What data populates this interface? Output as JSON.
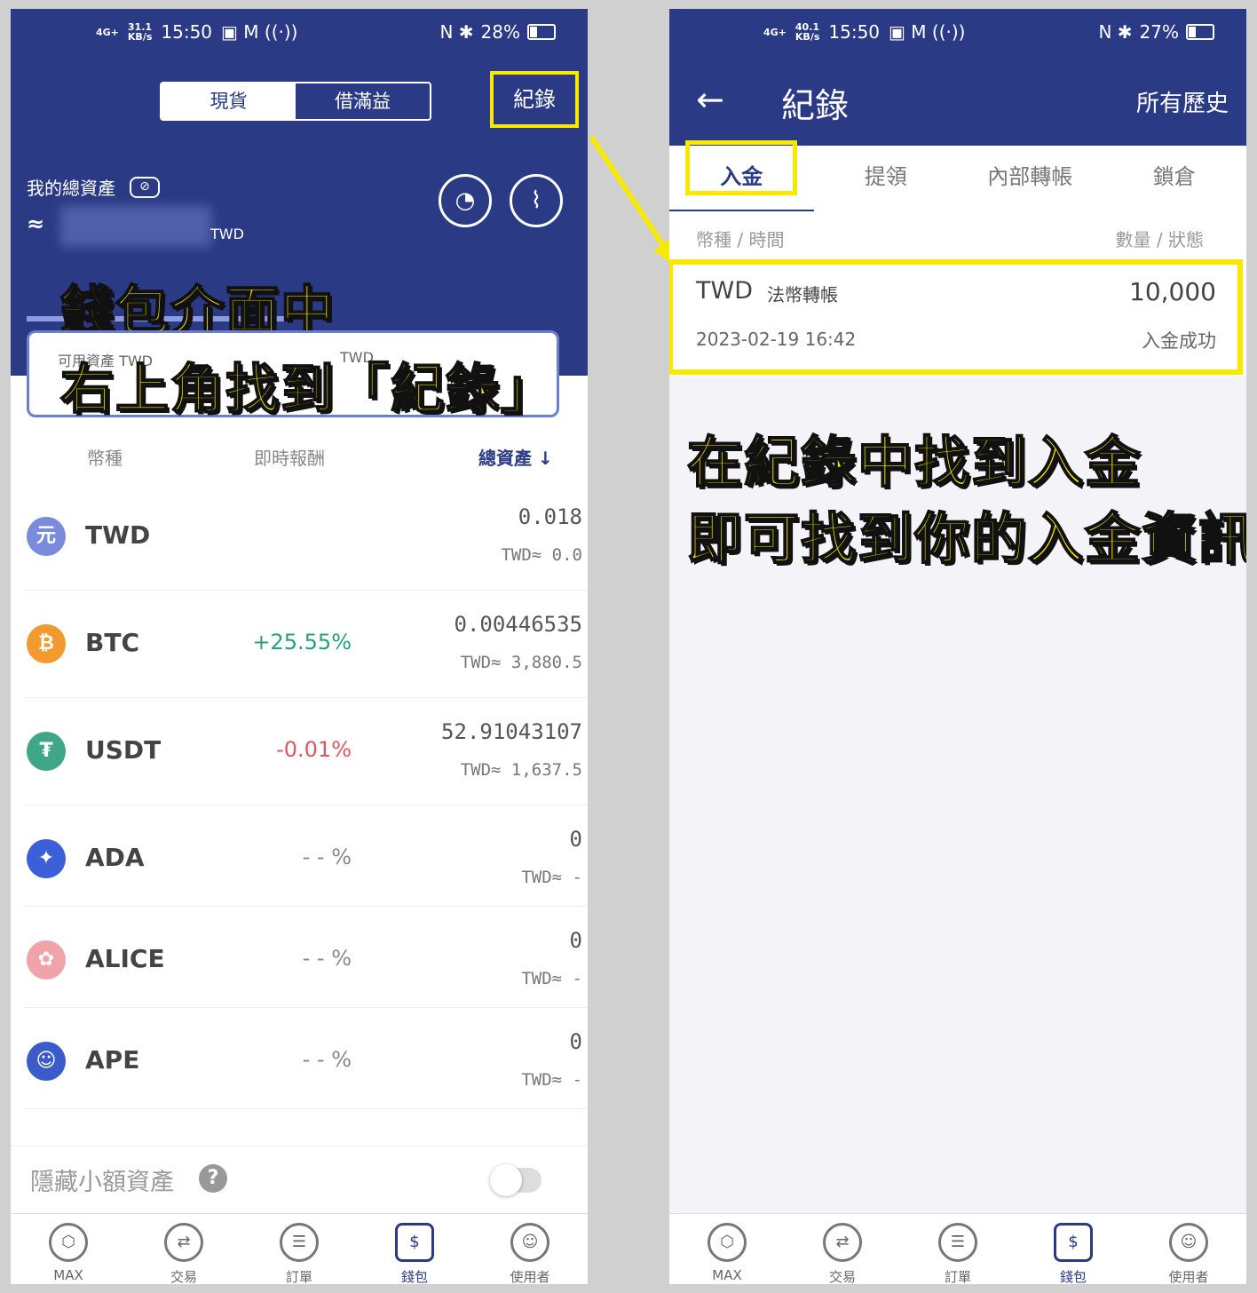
{
  "left": {
    "status": {
      "net": "4G+",
      "speed": "31.1",
      "speed_unit": "KB/s",
      "time": "15:50",
      "battery": "28%"
    },
    "segment": [
      "現貨",
      "借滿益"
    ],
    "records_link": "紀錄",
    "total_label": "我的總資產",
    "currency": "TWD",
    "overlay_line1": "錢包介面中",
    "overlay_line2": "右上角找到「紀錄」",
    "columns": {
      "coin": "幣種",
      "pnl": "即時報酬",
      "total": "總資產 ↓"
    },
    "coins": [
      {
        "icon": "元",
        "name": "TWD",
        "pct": "",
        "amount": "0.018",
        "twd": "TWD≈ 0.0",
        "color": "#7a8bdb"
      },
      {
        "icon": "₿",
        "name": "BTC",
        "pct": "+25.55%",
        "amount": "0.00446535",
        "twd": "TWD≈ 3,880.5",
        "color": "#f29a2e"
      },
      {
        "icon": "₮",
        "name": "USDT",
        "pct": "-0.01%",
        "amount": "52.91043107",
        "twd": "TWD≈ 1,637.5",
        "color": "#3fa687"
      },
      {
        "icon": "✦",
        "name": "ADA",
        "pct": "- - %",
        "amount": "0",
        "twd": "TWD≈ -",
        "color": "#3b5fd9"
      },
      {
        "icon": "✿",
        "name": "ALICE",
        "pct": "- - %",
        "amount": "0",
        "twd": "TWD≈ -",
        "color": "#f0a3a8"
      },
      {
        "icon": "☺",
        "name": "APE",
        "pct": "- - %",
        "amount": "0",
        "twd": "TWD≈ -",
        "color": "#3a5bc9"
      }
    ],
    "hide_small": "隱藏小額資產",
    "nav": [
      "MAX",
      "交易",
      "訂單",
      "錢包",
      "使用者"
    ]
  },
  "right": {
    "status": {
      "net": "4G+",
      "speed": "40.1",
      "speed_unit": "KB/s",
      "time": "15:50",
      "battery": "27%"
    },
    "title": "紀錄",
    "history": "所有歷史",
    "tabs": [
      "入金",
      "提領",
      "內部轉帳",
      "鎖倉"
    ],
    "col_left": "幣種 / 時間",
    "col_right": "數量 / 狀態",
    "record": {
      "currency": "TWD",
      "type": "法幣轉帳",
      "amount": "10,000",
      "date": "2023-02-19 16:42",
      "status": "入金成功"
    },
    "caption1": "在紀錄中找到入金",
    "caption2": "即可找到你的入金資訊",
    "nav": [
      "MAX",
      "交易",
      "訂單",
      "錢包",
      "使用者"
    ]
  }
}
